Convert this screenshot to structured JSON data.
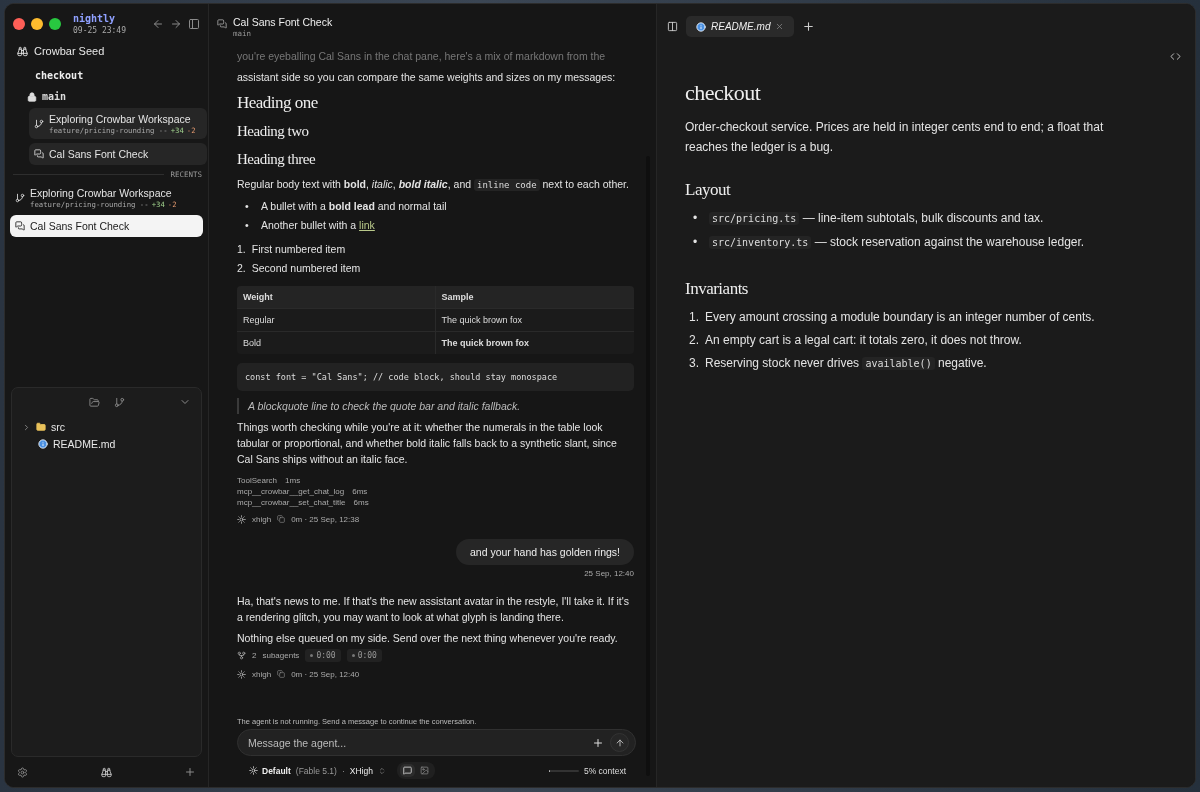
{
  "window": {
    "title": "nightly",
    "timestamp": "09-25 23:49"
  },
  "sidebar": {
    "workspace": "Crowbar Seed",
    "project": "checkout",
    "branch": {
      "name": "main",
      "locked": true
    },
    "threads": [
      {
        "kind": "branch",
        "title": "Exploring Crowbar Workspace",
        "branch": "feature/pricing-rounding --",
        "added": "+34",
        "removed": "-2",
        "selected": false
      },
      {
        "kind": "chat",
        "title": "Cal Sans Font Check",
        "selected": false
      }
    ],
    "recents_label": "RECENTS",
    "recents": [
      {
        "kind": "branch",
        "title": "Exploring Crowbar Workspace",
        "branch": "feature/pricing-rounding --",
        "added": "+34",
        "removed": "-2",
        "selected": false
      },
      {
        "kind": "chat",
        "title": "Cal Sans Font Check",
        "selected": true
      }
    ],
    "files": [
      {
        "kind": "folder",
        "name": "src",
        "expanded": false
      },
      {
        "kind": "file",
        "name": "README.md"
      }
    ]
  },
  "chat": {
    "title": "Cal Sans Font Check",
    "branch": "main",
    "blocks": [
      {
        "kind": "paragraph",
        "faded": true,
        "segments": [
          {
            "kind": "text",
            "text": "you're eyeballing Cal Sans in the chat pane, here's a mix of markdown from the"
          }
        ]
      },
      {
        "kind": "paragraph",
        "segments": [
          {
            "kind": "text",
            "text": "assistant side so you can compare the same weights and sizes on my messages:"
          }
        ]
      },
      {
        "kind": "heading1",
        "text": "Heading one"
      },
      {
        "kind": "heading2",
        "text": "Heading two"
      },
      {
        "kind": "heading3",
        "text": "Heading three"
      },
      {
        "kind": "paragraph",
        "segments": [
          {
            "kind": "text",
            "text": "Regular body text with **bold**, *italic*, "
          },
          {
            "kind": "bolditalic",
            "text": "bold italic"
          },
          {
            "kind": "text",
            "text": ", and "
          },
          {
            "kind": "code",
            "text": "inline code"
          },
          {
            "kind": "text",
            "text": " next to each other."
          }
        ]
      },
      {
        "kind": "bullets",
        "items": [
          {
            "marker": "•",
            "segments": [
              {
                "kind": "text",
                "text": "A bullet with a **bold lead** and normal tail"
              }
            ]
          },
          {
            "marker": "•",
            "segments": [
              {
                "kind": "text",
                "text": "Another bullet with a "
              },
              {
                "kind": "link",
                "text": "link"
              }
            ]
          }
        ]
      },
      {
        "kind": "numbered",
        "items": [
          {
            "marker": "1.",
            "segments": [
              {
                "kind": "text",
                "text": "First numbered item"
              }
            ]
          },
          {
            "marker": "2.",
            "segments": [
              {
                "kind": "text",
                "text": "Second numbered item"
              }
            ]
          }
        ]
      },
      {
        "kind": "table",
        "columns": [
          "Weight",
          "Sample"
        ],
        "rows": [
          [
            "Regular",
            "The quick brown fox"
          ],
          [
            "Bold",
            "**The quick brown fox**"
          ]
        ]
      },
      {
        "kind": "code",
        "text": "const font = \"Cal Sans\"; // code block, should stay monospace"
      },
      {
        "kind": "quote",
        "text": "A blockquote line to check the quote bar and italic fallback."
      },
      {
        "kind": "paragraph",
        "segments": [
          {
            "kind": "text",
            "text": "Things worth checking while you're at it: whether the numerals in the table look tabular or proportional, and whether bold italic falls back to a synthetic slant, since Cal Sans ships without an italic face."
          }
        ]
      },
      {
        "kind": "tools",
        "calls": [
          {
            "name": "ToolSearch",
            "duration": "1ms"
          },
          {
            "name": "mcp__crowbar__get_chat_log",
            "duration": "6ms"
          },
          {
            "name": "mcp__crowbar__set_chat_title",
            "duration": "6ms"
          }
        ]
      },
      {
        "kind": "meta",
        "effort": "xhigh",
        "time": "0m · 25 Sep, 12:38"
      },
      {
        "kind": "user",
        "text": "and your hand has golden rings!",
        "time": "25 Sep, 12:40"
      },
      {
        "kind": "paragraph",
        "segments": [
          {
            "kind": "text",
            "text": "Ha, that's news to me. If that's the new assistant avatar in the restyle, I'll take it. If it's a rendering glitch, you may want to look at what glyph is landing there."
          }
        ]
      },
      {
        "kind": "paragraph",
        "segments": [
          {
            "kind": "text",
            "text": "Nothing else queued on my side. Send over the next thing whenever you're ready."
          }
        ]
      },
      {
        "kind": "subagents",
        "count": "2",
        "label": "subagents",
        "timers": [
          "0:00",
          "0:00"
        ]
      },
      {
        "kind": "meta",
        "effort": "xhigh",
        "time": "0m · 25 Sep, 12:40"
      }
    ],
    "notice": "The agent is not running. Send a message to continue the conversation.",
    "composer": {
      "placeholder": "Message the agent..."
    },
    "toolbar": {
      "mode": "Default",
      "model": "(Fable 5.1)",
      "separator": "·",
      "effort": "XHigh",
      "views": [
        {
          "kind": "chat",
          "selected": true
        },
        {
          "kind": "image",
          "selected": false
        }
      ],
      "context": {
        "level": 0.05,
        "reading": "5% context"
      }
    }
  },
  "preview": {
    "tabs": [
      {
        "name": "README.md",
        "selected": true
      }
    ],
    "blocks": [
      {
        "kind": "heading1",
        "text": "checkout"
      },
      {
        "kind": "paragraph",
        "segments": [
          {
            "kind": "text",
            "text": "Order-checkout service. Prices are held in integer cents end to end; a float that reaches the ledger is a bug."
          }
        ]
      },
      {
        "kind": "heading2",
        "text": "Layout"
      },
      {
        "kind": "bullets",
        "items": [
          {
            "marker": "•",
            "segments": [
              {
                "kind": "code",
                "text": "src/pricing.ts"
              },
              {
                "kind": "text",
                "text": " — line-item subtotals, bulk discounts and tax."
              }
            ]
          },
          {
            "marker": "•",
            "segments": [
              {
                "kind": "code",
                "text": "src/inventory.ts"
              },
              {
                "kind": "text",
                "text": " — stock reservation against the warehouse ledger."
              }
            ]
          }
        ]
      },
      {
        "kind": "heading2",
        "text": "Invariants"
      },
      {
        "kind": "numbered",
        "items": [
          {
            "marker": "1.",
            "segments": [
              {
                "kind": "text",
                "text": "Every amount crossing a module boundary is an integer number of cents."
              }
            ]
          },
          {
            "marker": "2.",
            "segments": [
              {
                "kind": "text",
                "text": "An empty cart is a legal cart: it totals zero, it does not throw."
              }
            ]
          },
          {
            "marker": "3.",
            "segments": [
              {
                "kind": "text",
                "text": "Reserving stock never drives "
              },
              {
                "kind": "code",
                "text": "available()"
              },
              {
                "kind": "text",
                "text": " negative."
              }
            ]
          }
        ]
      }
    ]
  }
}
